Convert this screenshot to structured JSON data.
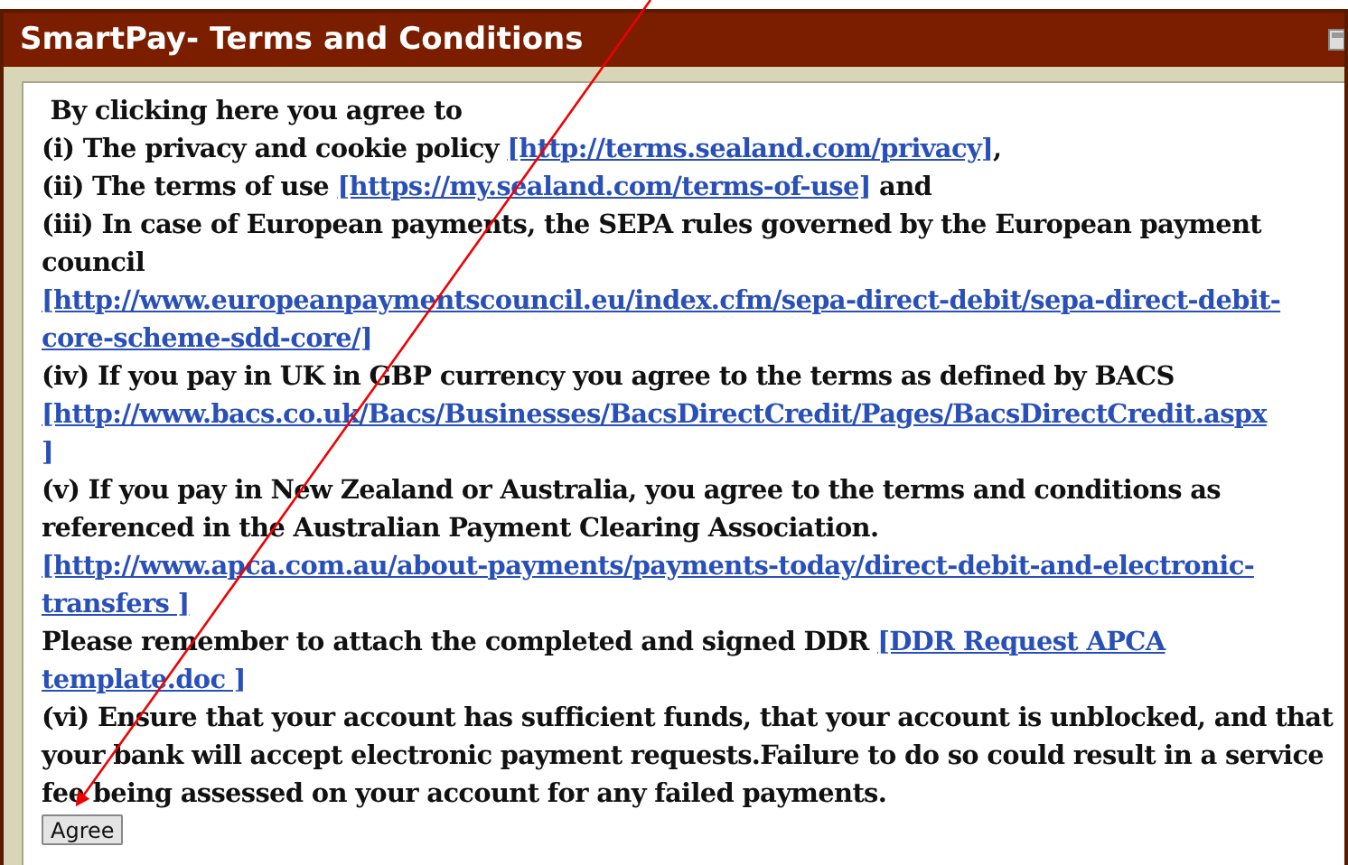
{
  "dialog": {
    "title": "SmartPay- Terms and Conditions",
    "paragraphs": [
      {
        "text": " By clicking here you agree to"
      },
      {
        "text": "(i) The privacy and cookie policy",
        "link_lines": [
          "[http://terms.sealand.com/privacy]"
        ],
        "after": ","
      },
      {
        "text": "(ii) The terms of use",
        "link_lines": [
          "[https://my.sealand.com/terms-of-use]"
        ],
        "after": "and"
      },
      {
        "text": "(iii) In case of European payments, the SEPA rules governed by the European payment council",
        "link_lines": [
          "[http://www.europeanpaymentscouncil.eu/index.cfm/sepa-direct-debit/sepa-direct-debit-",
          "core-scheme-sdd-core/]"
        ]
      },
      {
        "text": "(iv) If you pay in UK in GBP currency you agree to the terms as defined by BACS",
        "link_lines": [
          "[http://www.bacs.co.uk/Bacs/Businesses/BacsDirectCredit/Pages/BacsDirectCredit.aspx",
          "]"
        ]
      },
      {
        "text": "(v) If you pay in New Zealand or Australia, you agree to the terms and conditions as referenced in the Australian Payment Clearing Association.",
        "link_lines": [
          "[http://www.apca.com.au/about-payments/payments-today/direct-debit-and-electronic-",
          "transfers ]"
        ]
      },
      {
        "text": "Please remember to attach the completed and signed DDR",
        "link_lines": [
          "[DDR Request APCA",
          "template.doc ]"
        ]
      },
      {
        "text": "(vi) Ensure that your account has sufficient funds, that your account is unblocked, and that your bank will accept electronic payment requests.Failure to do so could result in a service fee being assessed on your account for any failed payments."
      }
    ],
    "button": "Agree"
  }
}
